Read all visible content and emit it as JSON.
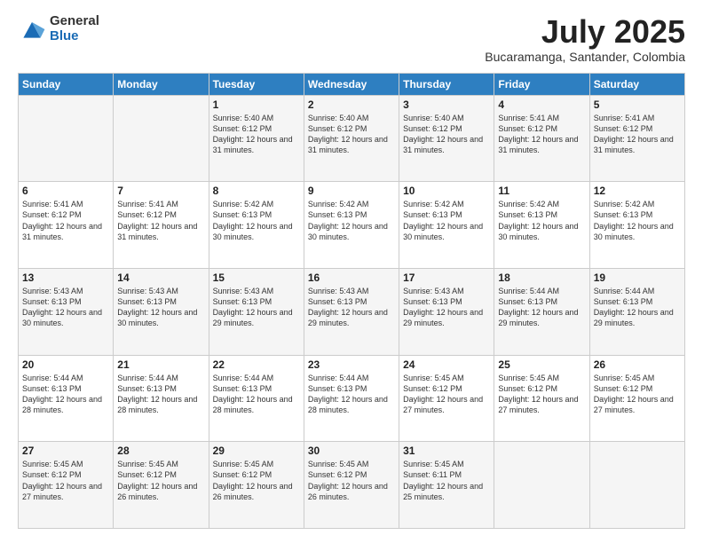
{
  "header": {
    "logo": {
      "general": "General",
      "blue": "Blue"
    },
    "title": "July 2025",
    "subtitle": "Bucaramanga, Santander, Colombia"
  },
  "weekdays": [
    "Sunday",
    "Monday",
    "Tuesday",
    "Wednesday",
    "Thursday",
    "Friday",
    "Saturday"
  ],
  "weeks": [
    [
      {
        "day": "",
        "info": ""
      },
      {
        "day": "",
        "info": ""
      },
      {
        "day": "1",
        "info": "Sunrise: 5:40 AM\nSunset: 6:12 PM\nDaylight: 12 hours and 31 minutes."
      },
      {
        "day": "2",
        "info": "Sunrise: 5:40 AM\nSunset: 6:12 PM\nDaylight: 12 hours and 31 minutes."
      },
      {
        "day": "3",
        "info": "Sunrise: 5:40 AM\nSunset: 6:12 PM\nDaylight: 12 hours and 31 minutes."
      },
      {
        "day": "4",
        "info": "Sunrise: 5:41 AM\nSunset: 6:12 PM\nDaylight: 12 hours and 31 minutes."
      },
      {
        "day": "5",
        "info": "Sunrise: 5:41 AM\nSunset: 6:12 PM\nDaylight: 12 hours and 31 minutes."
      }
    ],
    [
      {
        "day": "6",
        "info": "Sunrise: 5:41 AM\nSunset: 6:12 PM\nDaylight: 12 hours and 31 minutes."
      },
      {
        "day": "7",
        "info": "Sunrise: 5:41 AM\nSunset: 6:12 PM\nDaylight: 12 hours and 31 minutes."
      },
      {
        "day": "8",
        "info": "Sunrise: 5:42 AM\nSunset: 6:13 PM\nDaylight: 12 hours and 30 minutes."
      },
      {
        "day": "9",
        "info": "Sunrise: 5:42 AM\nSunset: 6:13 PM\nDaylight: 12 hours and 30 minutes."
      },
      {
        "day": "10",
        "info": "Sunrise: 5:42 AM\nSunset: 6:13 PM\nDaylight: 12 hours and 30 minutes."
      },
      {
        "day": "11",
        "info": "Sunrise: 5:42 AM\nSunset: 6:13 PM\nDaylight: 12 hours and 30 minutes."
      },
      {
        "day": "12",
        "info": "Sunrise: 5:42 AM\nSunset: 6:13 PM\nDaylight: 12 hours and 30 minutes."
      }
    ],
    [
      {
        "day": "13",
        "info": "Sunrise: 5:43 AM\nSunset: 6:13 PM\nDaylight: 12 hours and 30 minutes."
      },
      {
        "day": "14",
        "info": "Sunrise: 5:43 AM\nSunset: 6:13 PM\nDaylight: 12 hours and 30 minutes."
      },
      {
        "day": "15",
        "info": "Sunrise: 5:43 AM\nSunset: 6:13 PM\nDaylight: 12 hours and 29 minutes."
      },
      {
        "day": "16",
        "info": "Sunrise: 5:43 AM\nSunset: 6:13 PM\nDaylight: 12 hours and 29 minutes."
      },
      {
        "day": "17",
        "info": "Sunrise: 5:43 AM\nSunset: 6:13 PM\nDaylight: 12 hours and 29 minutes."
      },
      {
        "day": "18",
        "info": "Sunrise: 5:44 AM\nSunset: 6:13 PM\nDaylight: 12 hours and 29 minutes."
      },
      {
        "day": "19",
        "info": "Sunrise: 5:44 AM\nSunset: 6:13 PM\nDaylight: 12 hours and 29 minutes."
      }
    ],
    [
      {
        "day": "20",
        "info": "Sunrise: 5:44 AM\nSunset: 6:13 PM\nDaylight: 12 hours and 28 minutes."
      },
      {
        "day": "21",
        "info": "Sunrise: 5:44 AM\nSunset: 6:13 PM\nDaylight: 12 hours and 28 minutes."
      },
      {
        "day": "22",
        "info": "Sunrise: 5:44 AM\nSunset: 6:13 PM\nDaylight: 12 hours and 28 minutes."
      },
      {
        "day": "23",
        "info": "Sunrise: 5:44 AM\nSunset: 6:13 PM\nDaylight: 12 hours and 28 minutes."
      },
      {
        "day": "24",
        "info": "Sunrise: 5:45 AM\nSunset: 6:12 PM\nDaylight: 12 hours and 27 minutes."
      },
      {
        "day": "25",
        "info": "Sunrise: 5:45 AM\nSunset: 6:12 PM\nDaylight: 12 hours and 27 minutes."
      },
      {
        "day": "26",
        "info": "Sunrise: 5:45 AM\nSunset: 6:12 PM\nDaylight: 12 hours and 27 minutes."
      }
    ],
    [
      {
        "day": "27",
        "info": "Sunrise: 5:45 AM\nSunset: 6:12 PM\nDaylight: 12 hours and 27 minutes."
      },
      {
        "day": "28",
        "info": "Sunrise: 5:45 AM\nSunset: 6:12 PM\nDaylight: 12 hours and 26 minutes."
      },
      {
        "day": "29",
        "info": "Sunrise: 5:45 AM\nSunset: 6:12 PM\nDaylight: 12 hours and 26 minutes."
      },
      {
        "day": "30",
        "info": "Sunrise: 5:45 AM\nSunset: 6:12 PM\nDaylight: 12 hours and 26 minutes."
      },
      {
        "day": "31",
        "info": "Sunrise: 5:45 AM\nSunset: 6:11 PM\nDaylight: 12 hours and 25 minutes."
      },
      {
        "day": "",
        "info": ""
      },
      {
        "day": "",
        "info": ""
      }
    ]
  ]
}
